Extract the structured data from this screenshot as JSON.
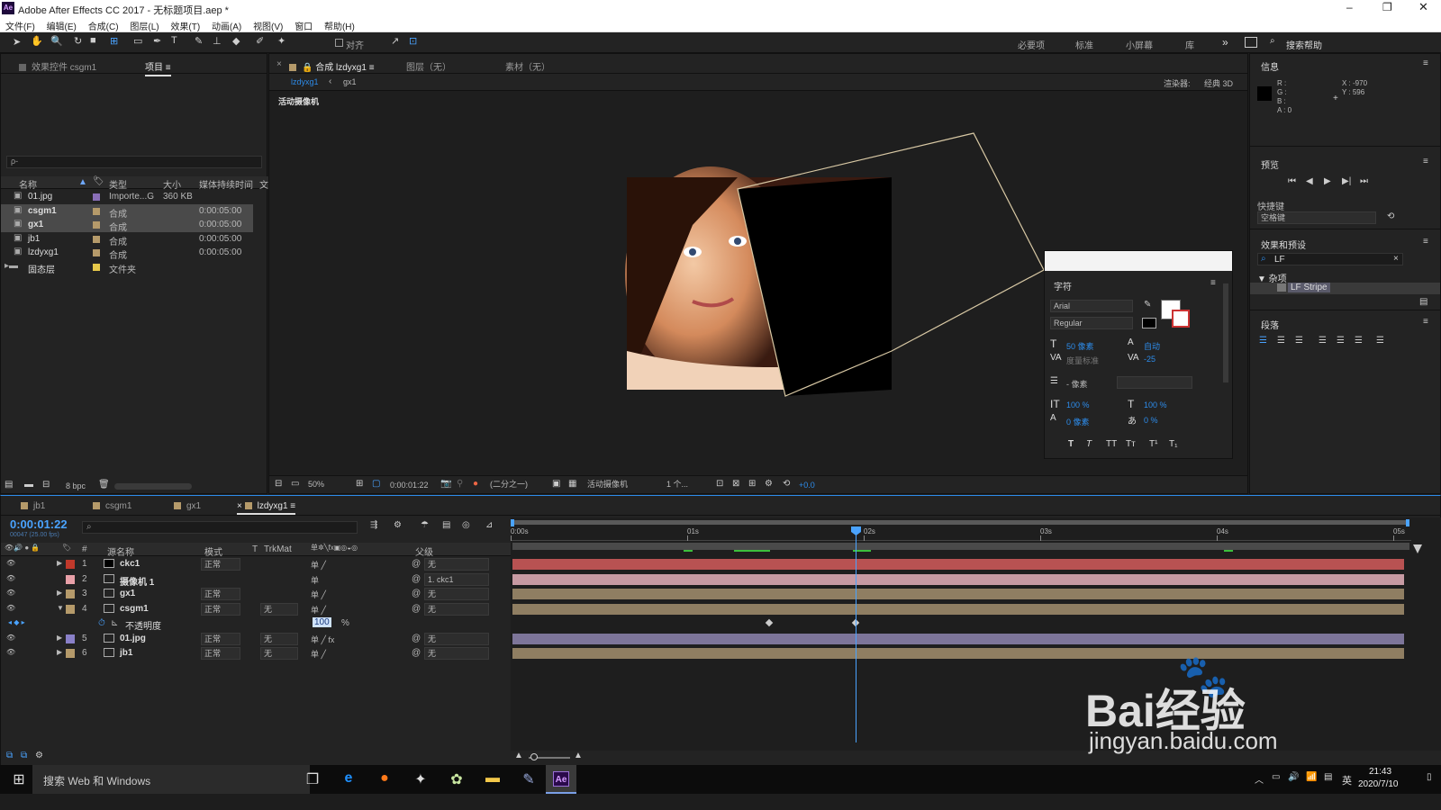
{
  "window": {
    "title": "Adobe After Effects CC 2017 - 无标题项目.aep *",
    "app_badge": "Ae"
  },
  "menu": [
    "文件(F)",
    "编辑(E)",
    "合成(C)",
    "图层(L)",
    "效果(T)",
    "动画(A)",
    "视图(V)",
    "窗口",
    "帮助(H)"
  ],
  "toolbar": {
    "snap_label": "对齐",
    "workspaces": [
      "必要项",
      "标准",
      "小屏幕",
      "库"
    ],
    "more": "»",
    "search_placeholder": "搜索帮助"
  },
  "project_panel": {
    "tab_effect": "效果控件 csgm1",
    "tab_project": "项目",
    "search_placeholder": "ρ-",
    "columns": [
      "名称",
      "类型",
      "大小",
      "媒体持续时间",
      "文"
    ],
    "items": [
      {
        "name": "01.jpg",
        "type": "Importe...G",
        "size": "360 KB",
        "duration": "",
        "color": "#8a6fb8"
      },
      {
        "name": "csgm1",
        "type": "合成",
        "size": "",
        "duration": "0:00:05:00",
        "color": "#b59a6a"
      },
      {
        "name": "gx1",
        "type": "合成",
        "size": "",
        "duration": "0:00:05:00",
        "color": "#b59a6a"
      },
      {
        "name": "jb1",
        "type": "合成",
        "size": "",
        "duration": "0:00:05:00",
        "color": "#b59a6a"
      },
      {
        "name": "lzdyxg1",
        "type": "合成",
        "size": "",
        "duration": "0:00:05:00",
        "color": "#b59a6a"
      },
      {
        "name": "固态层",
        "type": "文件夹",
        "size": "",
        "duration": "",
        "color": "#e6c84a"
      }
    ],
    "bpc": "8 bpc"
  },
  "comp_panel": {
    "tab_comp": "合成 lzdyxg1",
    "tab_layer": "图层（无）",
    "tab_footage": "素材（无）",
    "breadcrumb": [
      "lzdyxg1",
      "gx1"
    ],
    "renderer_label": "渲染器:",
    "renderer_value": "经典 3D",
    "camera_label": "活动摄像机",
    "bottom": {
      "zoom": "50%",
      "time": "0:00:01:22",
      "resolution": "(二分之一)",
      "camera": "活动摄像机",
      "views": "1 个...",
      "exposure": "+0.0"
    }
  },
  "character_panel": {
    "title": "字符",
    "font": "Arial",
    "style": "Regular",
    "size": "50 像素",
    "leading": "自动",
    "kerning": "度量标准",
    "tracking": "-25",
    "stroke": "- 像素",
    "vscale": "100 %",
    "hscale": "100 %",
    "baseline": "0 像素",
    "tsume": "0 %",
    "styles": [
      "T",
      "T",
      "TT",
      "Tт",
      "T¹",
      "T₁"
    ]
  },
  "info_panel": {
    "title": "信息",
    "r": "R :",
    "g": "G :",
    "b": "B :",
    "a": "A : 0",
    "x": "X : -970",
    "y": "Y : 596"
  },
  "preview_panel": {
    "title": "预览",
    "shortcut_label": "快捷键",
    "shortcut_value": "空格键"
  },
  "effects_panel": {
    "title": "效果和预设",
    "search": "LF",
    "category": "▼ 杂项",
    "effect": "LF Stripe"
  },
  "paragraph_panel": {
    "title": "段落"
  },
  "timeline": {
    "tabs": [
      "jb1",
      "csgm1",
      "gx1",
      "lzdyxg1"
    ],
    "timecode": "0:00:01:22",
    "timecode_sub": "00047 (25.00 fps)",
    "headers": {
      "num": "#",
      "name": "源名称",
      "mode": "模式",
      "t": "T",
      "trkmat": "TrkMat",
      "parent": "父级"
    },
    "ruler": [
      "0:00s",
      "01s",
      "02s",
      "03s",
      "04s",
      "05s"
    ],
    "layers": [
      {
        "num": "1",
        "name": "ckc1",
        "mode": "正常",
        "trk": "",
        "parent": "无",
        "color": "#c0392b",
        "bar": "#b85252"
      },
      {
        "num": "2",
        "name": "摄像机 1",
        "mode": "",
        "trk": "",
        "parent": "1. ckc1",
        "color": "#e8a0a8",
        "bar": "#c79aa3"
      },
      {
        "num": "3",
        "name": "gx1",
        "mode": "正常",
        "trk": "",
        "parent": "无",
        "color": "#b59a6a",
        "bar": "#8f7e62"
      },
      {
        "num": "4",
        "name": "csgm1",
        "mode": "正常",
        "trk": "无",
        "parent": "无",
        "color": "#b59a6a",
        "bar": "#8f7e62"
      },
      {
        "num": "5",
        "name": "01.jpg",
        "mode": "正常",
        "trk": "无",
        "parent": "无",
        "color": "#8a80c8",
        "bar": "#7d7599"
      },
      {
        "num": "6",
        "name": "jb1",
        "mode": "正常",
        "trk": "无",
        "parent": "无",
        "color": "#b59a6a",
        "bar": "#8f7e62"
      }
    ],
    "opacity": {
      "label": "不透明度",
      "value": "100",
      "unit": "%"
    }
  },
  "taskbar": {
    "search": "搜索 Web 和 Windows",
    "time": "21:43",
    "date": "2020/7/10",
    "ime": "英"
  },
  "watermark": {
    "brand": "Bai经验",
    "url": "jingyan.baidu.com"
  }
}
